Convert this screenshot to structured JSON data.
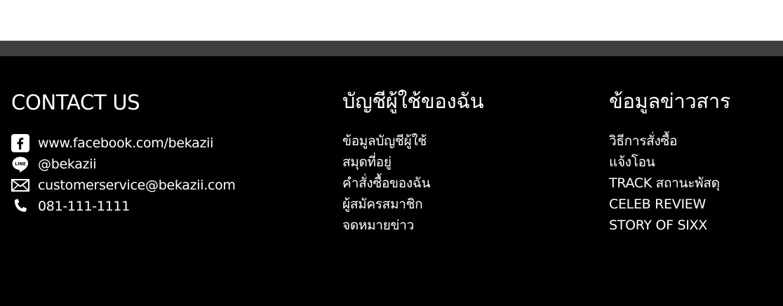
{
  "colors": {
    "footer_bg": "#000000",
    "divider_bar": "#3f3f3f",
    "text": "#ffffff",
    "page_top": "#ffffff"
  },
  "contact": {
    "heading": "CONTACT US",
    "items": [
      {
        "icon": "facebook-icon",
        "text": "www.facebook.com/bekazii"
      },
      {
        "icon": "line-icon",
        "text": "@bekazii"
      },
      {
        "icon": "mail-icon",
        "text": "customerservice@bekazii.com"
      },
      {
        "icon": "phone-icon",
        "text": "081-111-1111"
      }
    ]
  },
  "account": {
    "heading": "บัญชีผู้ใช้ของฉัน",
    "links": [
      "ข้อมูลบัญชีผู้ใช้",
      "สมุดที่อยู่",
      "คำสั่งซื้อของฉัน",
      "ผู้สมัครสมาชิก",
      "จดหมายข่าว"
    ]
  },
  "news": {
    "heading": "ข้อมูลข่าวสาร",
    "links": [
      "วิธีการสั่งซื้อ",
      "แจ้งโอน",
      "TRACK สถานะพัสดุ",
      "CELEB REVIEW",
      "STORY OF SIXX"
    ]
  }
}
